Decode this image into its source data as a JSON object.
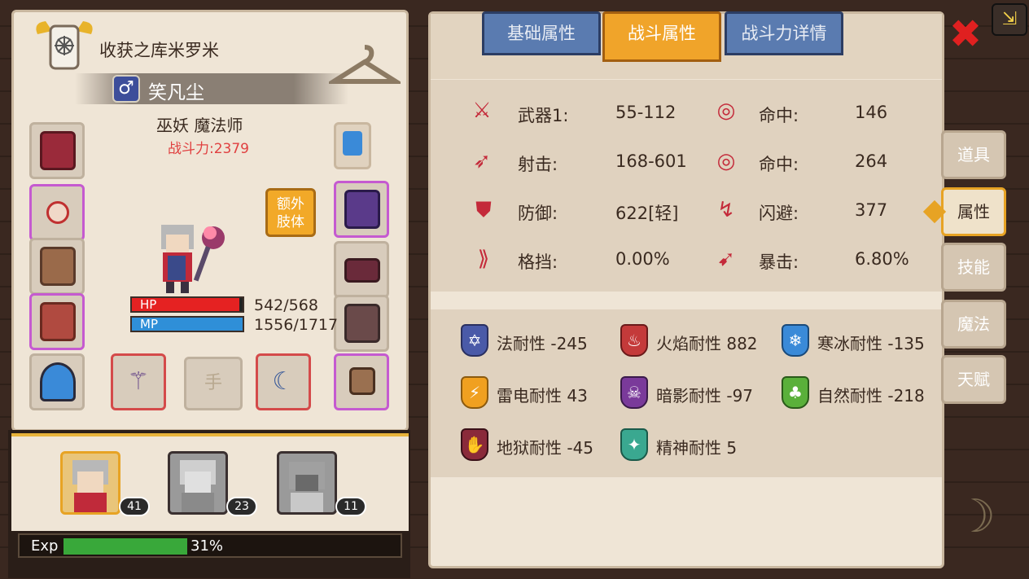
{
  "header": {
    "guild_name": "收获之库米罗米",
    "player_name": "笑凡尘",
    "gender_symbol": "♂",
    "class_text": "巫妖 魔法师",
    "power_text": "战斗力:2379"
  },
  "extra_limb_button": {
    "label": "额外\n肢体"
  },
  "hand_slot_label": "手",
  "vitals": {
    "hp_label": "HP",
    "hp_value": "542/568",
    "hp_fraction": 0.954,
    "mp_label": "MP",
    "mp_value": "1556/1717",
    "mp_fraction": 0.906
  },
  "party": [
    {
      "level": "41",
      "active": true
    },
    {
      "level": "23",
      "active": false
    },
    {
      "level": "11",
      "active": false
    }
  ],
  "exp": {
    "label": "Exp",
    "percent_text": "31%",
    "fraction": 0.31
  },
  "tabs": [
    {
      "label": "基础属性",
      "active": false
    },
    {
      "label": "战斗属性",
      "active": true
    },
    {
      "label": "战斗力详情",
      "active": false
    }
  ],
  "stats": [
    {
      "label": "武器1:",
      "value": "55-112",
      "icon": "sword-icon"
    },
    {
      "label": "命中:",
      "value": "146",
      "icon": "target-icon"
    },
    {
      "label": "射击:",
      "value": "168-601",
      "icon": "bow-icon"
    },
    {
      "label": "命中:",
      "value": "264",
      "icon": "target-icon"
    },
    {
      "label": "防御:",
      "value": "622[轻]",
      "icon": "shield-icon"
    },
    {
      "label": "闪避:",
      "value": "377",
      "icon": "dodge-icon"
    },
    {
      "label": "格挡:",
      "value": "0.00%",
      "icon": "block-icon"
    },
    {
      "label": "暴击:",
      "value": "6.80%",
      "icon": "critical-icon"
    }
  ],
  "resistances": [
    {
      "text": "法耐性 -245",
      "color": "#4a5aa8",
      "glyph": "✡"
    },
    {
      "text": "火焰耐性 882",
      "color": "#c43a3a",
      "glyph": "♨"
    },
    {
      "text": "寒冰耐性 -135",
      "color": "#3a8ad8",
      "glyph": "❄"
    },
    {
      "text": "雷电耐性 43",
      "color": "#f0a020",
      "glyph": "⚡"
    },
    {
      "text": "暗影耐性 -97",
      "color": "#7a3a9a",
      "glyph": "☠"
    },
    {
      "text": "自然耐性 -218",
      "color": "#5ab03a",
      "glyph": "♣"
    },
    {
      "text": "地狱耐性 -45",
      "color": "#8a2a3a",
      "glyph": "✋"
    },
    {
      "text": "精神耐性 5",
      "color": "#3aa890",
      "glyph": "✦"
    }
  ],
  "side_tabs": [
    {
      "label": "道具",
      "active": false
    },
    {
      "label": "属性",
      "active": true
    },
    {
      "label": "技能",
      "active": false
    },
    {
      "label": "魔法",
      "active": false
    },
    {
      "label": "天赋",
      "active": false
    }
  ]
}
